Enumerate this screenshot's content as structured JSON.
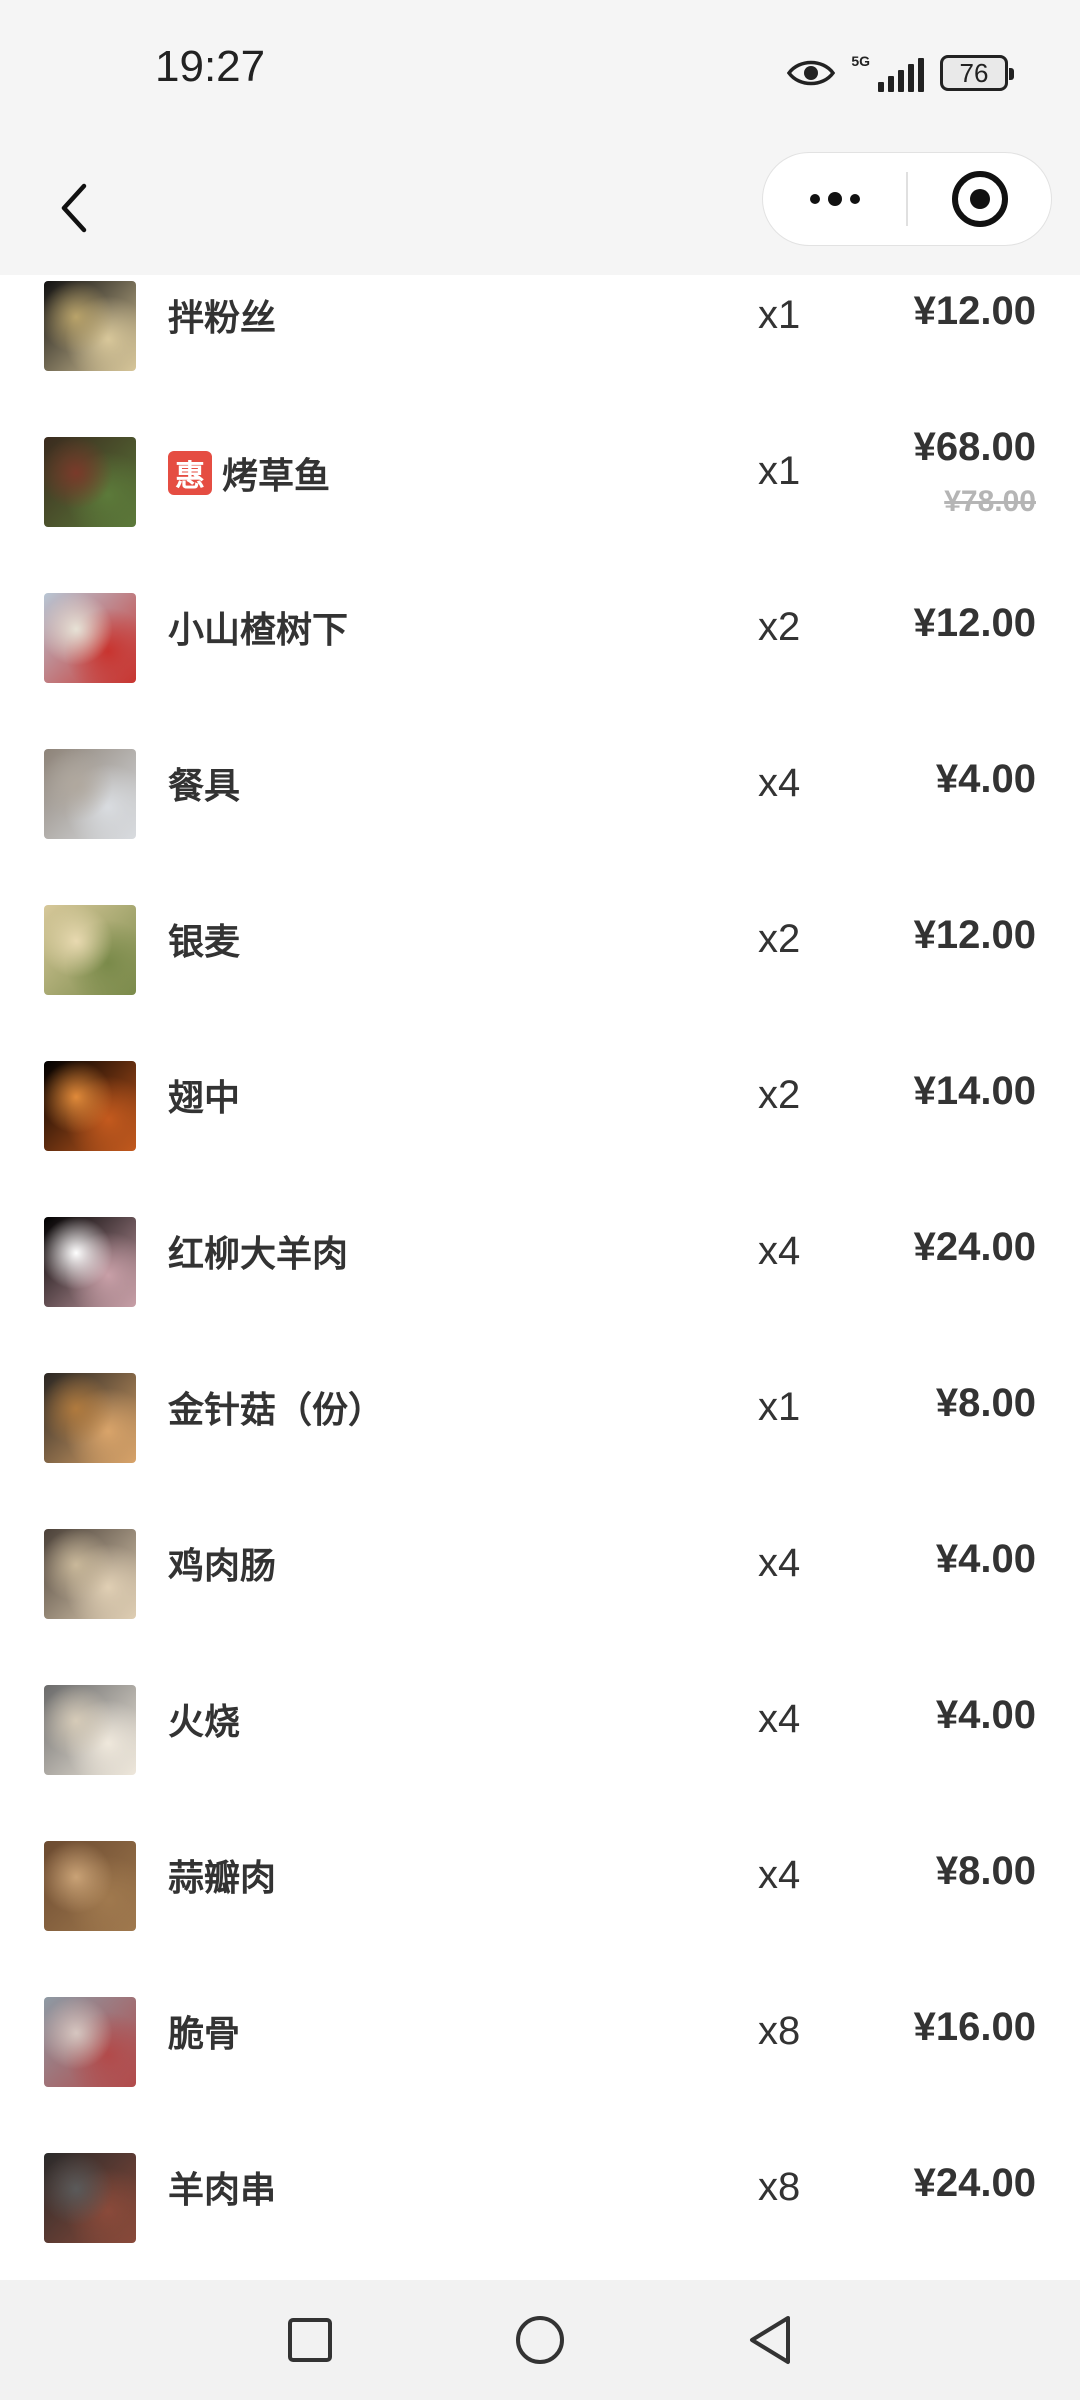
{
  "status_bar": {
    "time": "19:27",
    "network": "5G",
    "battery": "76"
  },
  "nav": {
    "back_icon": "chevron-left-icon",
    "more_icon": "more-dots-icon",
    "close_icon": "target-circle-icon"
  },
  "items": [
    {
      "name": "拌粉丝",
      "qty": "x1",
      "price": "¥12.00",
      "thumb_colors": [
        "#111111",
        "#d8c79a",
        "#b9a36a"
      ]
    },
    {
      "name": "烤草鱼",
      "badge": "惠",
      "qty": "x1",
      "price": "¥68.00",
      "original_price": "¥78.00",
      "thumb_colors": [
        "#3a2a1e",
        "#5c7a3a",
        "#7a3a2a"
      ]
    },
    {
      "name": "小山楂树下",
      "qty": "x2",
      "price": "¥12.00",
      "thumb_colors": [
        "#b8c6d4",
        "#c8342f",
        "#e7e2d6"
      ]
    },
    {
      "name": "餐具",
      "qty": "x4",
      "price": "¥4.00",
      "thumb_colors": [
        "#8d8378",
        "#d9dce0",
        "#b0a89e"
      ]
    },
    {
      "name": "银麦",
      "qty": "x2",
      "price": "¥12.00",
      "thumb_colors": [
        "#d7c89a",
        "#7a8a4a",
        "#e8d9b0"
      ]
    },
    {
      "name": "翅中",
      "qty": "x2",
      "price": "¥14.00",
      "thumb_colors": [
        "#000000",
        "#c45a1e",
        "#e08a3a"
      ]
    },
    {
      "name": "红柳大羊肉",
      "qty": "x4",
      "price": "¥24.00",
      "thumb_colors": [
        "#000000",
        "#c9a0a8",
        "#ffffff"
      ]
    },
    {
      "name": "金针菇（份）",
      "qty": "x1",
      "price": "¥8.00",
      "thumb_colors": [
        "#2a2622",
        "#d9a46a",
        "#b07a3e"
      ]
    },
    {
      "name": "鸡肉肠",
      "qty": "x4",
      "price": "¥4.00",
      "thumb_colors": [
        "#4a4038",
        "#e0cfb4",
        "#c9b89a"
      ]
    },
    {
      "name": "火烧",
      "qty": "x4",
      "price": "¥4.00",
      "thumb_colors": [
        "#6a6a6a",
        "#efe8dc",
        "#d6cbb8"
      ]
    },
    {
      "name": "蒜瓣肉",
      "qty": "x4",
      "price": "¥8.00",
      "thumb_colors": [
        "#6b4a30",
        "#a0794e",
        "#c9a276"
      ]
    },
    {
      "name": "脆骨",
      "qty": "x8",
      "price": "¥16.00",
      "thumb_colors": [
        "#8e9aa4",
        "#b24a4a",
        "#d6c6c0"
      ]
    },
    {
      "name": "羊肉串",
      "qty": "x8",
      "price": "¥24.00",
      "thumb_colors": [
        "#2a2a2a",
        "#8a4a3a",
        "#5a5a5a"
      ]
    }
  ],
  "system_nav": {
    "recents_icon": "square-icon",
    "home_icon": "circle-icon",
    "back_icon": "triangle-back-icon"
  }
}
